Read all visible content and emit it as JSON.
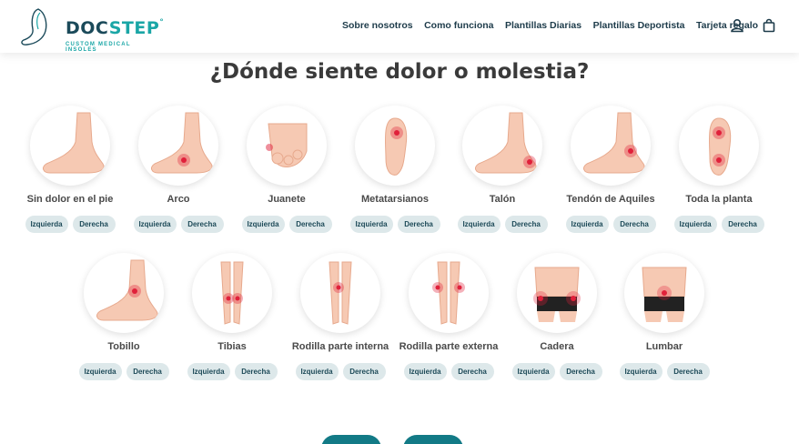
{
  "brand": {
    "name_a": "DOC",
    "name_b": "STEP",
    "tagline": "CUSTOM MEDICAL INSOLES"
  },
  "nav": [
    {
      "label": "Sobre nosotros"
    },
    {
      "label": "Como funciona"
    },
    {
      "label": "Plantillas Diarias"
    },
    {
      "label": "Plantillas Deportista"
    },
    {
      "label": "Tarjeta regalo"
    }
  ],
  "icons": {
    "account": "user-icon",
    "cart": "shopping-bag-icon"
  },
  "colors": {
    "accent": "#1aa6a6",
    "dark": "#1b4a5a",
    "pill_bg": "#dde8ea",
    "pain": "#e0203a"
  },
  "title": "¿Dónde siente dolor o molestia?",
  "left_label": "Izquierda",
  "right_label": "Derecha",
  "areas": [
    {
      "name": "Sin dolor en el pie"
    },
    {
      "name": "Arco"
    },
    {
      "name": "Juanete"
    },
    {
      "name": "Metatarsianos"
    },
    {
      "name": "Talón"
    },
    {
      "name": "Tendón de Aquiles"
    },
    {
      "name": "Toda la planta"
    },
    {
      "name": "Tobillo"
    },
    {
      "name": "Tibias"
    },
    {
      "name": "Rodilla parte interna"
    },
    {
      "name": "Rodilla parte externa"
    },
    {
      "name": "Cadera"
    },
    {
      "name": "Lumbar"
    }
  ]
}
